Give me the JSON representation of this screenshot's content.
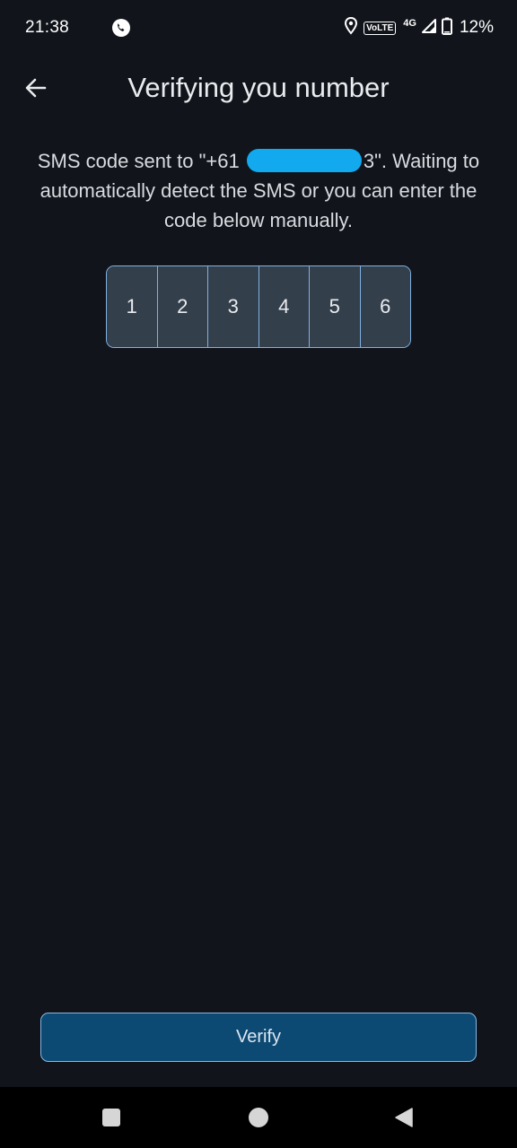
{
  "status_bar": {
    "time": "21:38",
    "volte": "VoLTE",
    "network": "4G",
    "battery": "12%"
  },
  "header": {
    "title": "Verifying you number",
    "back_icon": "arrow-left-icon"
  },
  "description": {
    "part1": "SMS code sent to \"+61 ",
    "part2": "3\". Waiting to automatically detect the SMS or you can enter the code below manually."
  },
  "code": {
    "digits": [
      "1",
      "2",
      "3",
      "4",
      "5",
      "6"
    ]
  },
  "actions": {
    "verify_label": "Verify"
  },
  "nav": {
    "recents_icon": "square-icon",
    "home_icon": "circle-icon",
    "back_icon": "triangle-back-icon"
  },
  "colors": {
    "background": "#11151b",
    "accent_border": "#7fb1e0",
    "button_fill": "#0d4a73",
    "code_fill": "#343f4c",
    "redaction": "#12a9ef"
  }
}
